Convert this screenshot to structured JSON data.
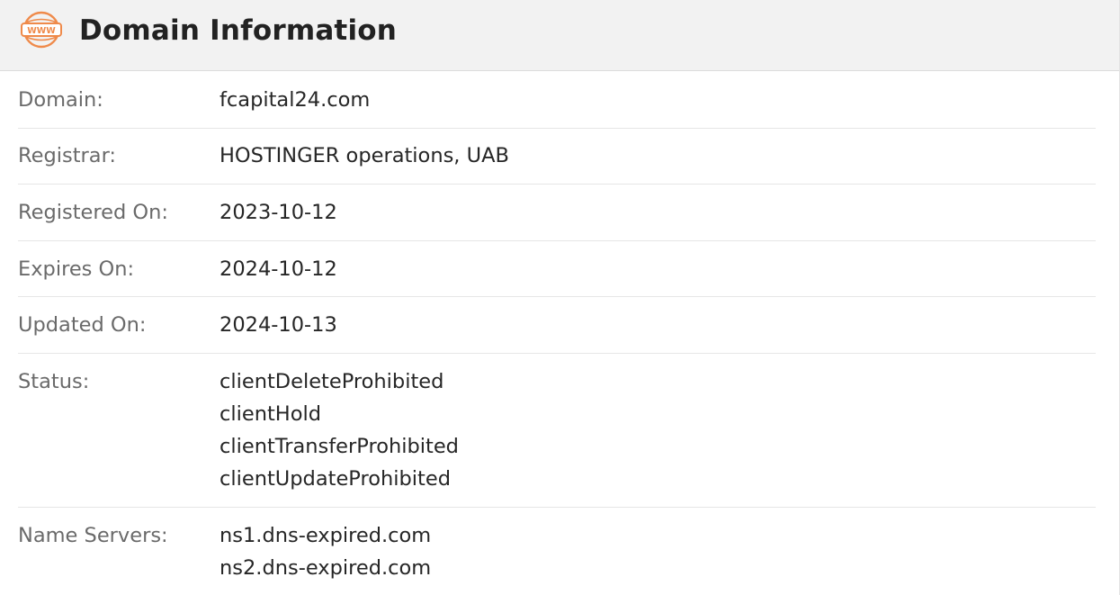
{
  "header": {
    "title": "Domain Information",
    "icon": "www-globe-icon",
    "icon_text": "WWW",
    "accent_color": "#ef8a4a"
  },
  "rows": {
    "domain": {
      "label": "Domain:",
      "value": "fcapital24.com"
    },
    "registrar": {
      "label": "Registrar:",
      "value": "HOSTINGER operations, UAB"
    },
    "registered_on": {
      "label": "Registered On:",
      "value": "2023-10-12"
    },
    "expires_on": {
      "label": "Expires On:",
      "value": "2024-10-12"
    },
    "updated_on": {
      "label": "Updated On:",
      "value": "2024-10-13"
    },
    "status": {
      "label": "Status:",
      "values": [
        "clientDeleteProhibited",
        "clientHold",
        "clientTransferProhibited",
        "clientUpdateProhibited"
      ]
    },
    "name_servers": {
      "label": "Name Servers:",
      "values": [
        "ns1.dns-expired.com",
        "ns2.dns-expired.com"
      ]
    }
  }
}
